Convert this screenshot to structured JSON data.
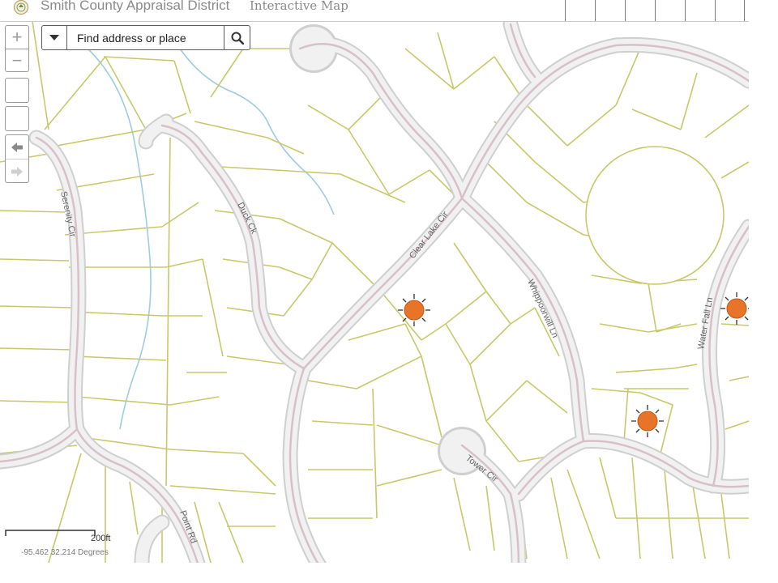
{
  "header": {
    "title": "Smith County Appraisal District",
    "subtitle": "Interactive Map",
    "logo_icon": "county-seal-icon",
    "toolbar_button_count": 6
  },
  "controls": {
    "zoom_in_glyph": "+",
    "zoom_out_glyph": "−",
    "back_icon": "arrow-left-icon",
    "forward_icon": "arrow-right-icon"
  },
  "search": {
    "placeholder": "Find address or place",
    "dropdown_icon": "caret-down-icon",
    "search_icon": "magnifier-icon"
  },
  "map": {
    "street_labels": {
      "serenity": "Serenity Cir",
      "duck": "Duck Ck",
      "clear_lake": "Clear Lake Cir",
      "whippoorwill": "Whippoorwill Ln",
      "water_fall": "Water Fall Ln",
      "tower": "Tower Cir",
      "point": "Point Rd"
    },
    "marker_icon": "sun-marker-icon",
    "marker_count": 3,
    "colors": {
      "parcel_line": "#c8c86a",
      "road_fill": "#f1f1f1",
      "road_edge": "#cfcfcf",
      "road_center": "#d8c0c8",
      "creek": "#9fcbe0",
      "marker": "#e8742a"
    }
  },
  "scale": {
    "label": "200ft"
  },
  "coordinates": {
    "text": "-95.462 32.214 Degrees"
  }
}
